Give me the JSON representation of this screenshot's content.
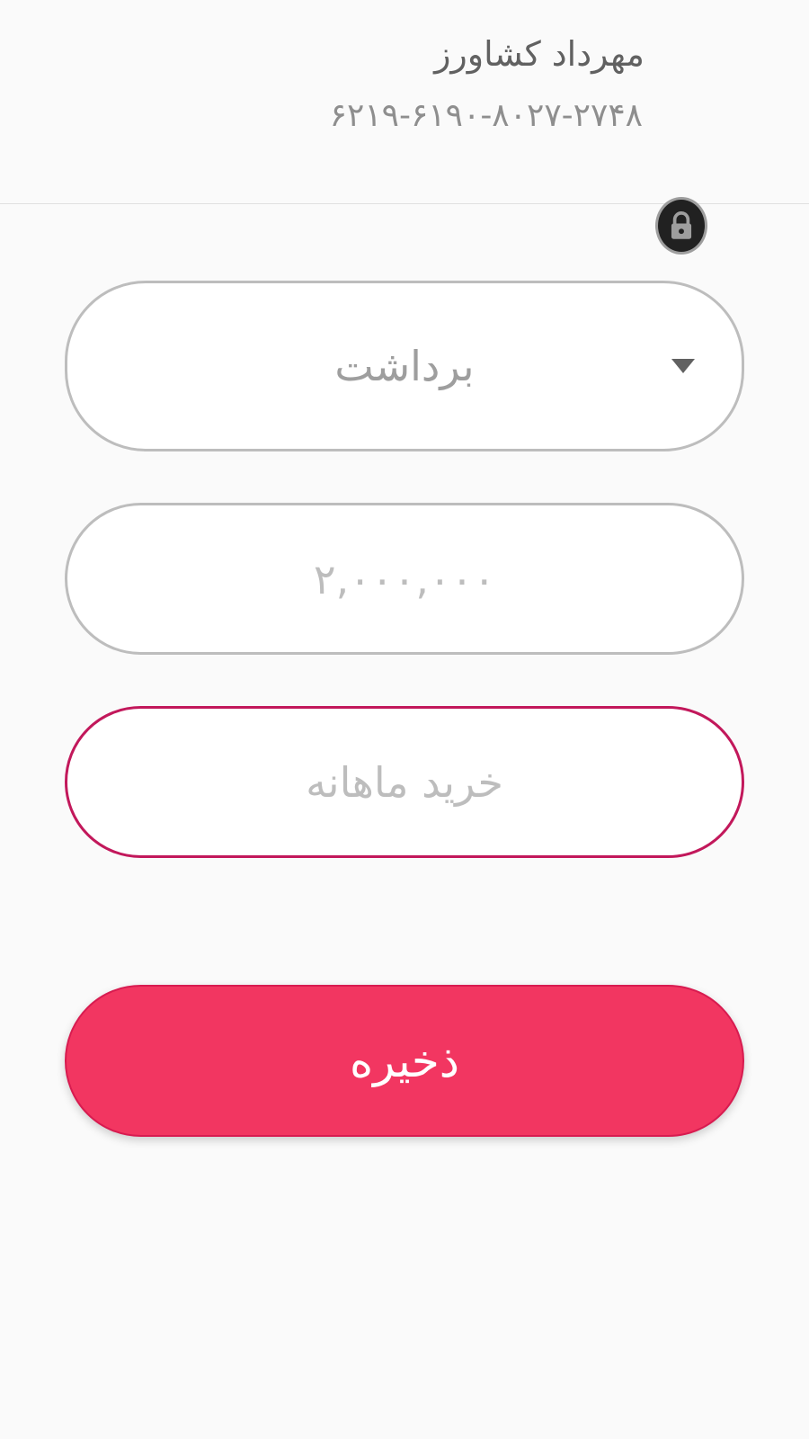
{
  "header": {
    "holder_name": "مهرداد کشاورز",
    "card_number": "۶۲۱۹-۶۱۹۰-۸۰۲۷-۲۷۴۸"
  },
  "lock": {
    "icon": "lock-icon"
  },
  "form": {
    "transaction_type": {
      "value": "برداشت",
      "icon": "triangle-down-icon"
    },
    "amount": {
      "value": "۲,۰۰۰,۰۰۰"
    },
    "description": {
      "value": "خرید ماهانه"
    }
  },
  "actions": {
    "save_label": "ذخیره"
  },
  "colors": {
    "accent": "#f23661",
    "focus_border": "#c2185b",
    "background": "#fafafa"
  }
}
